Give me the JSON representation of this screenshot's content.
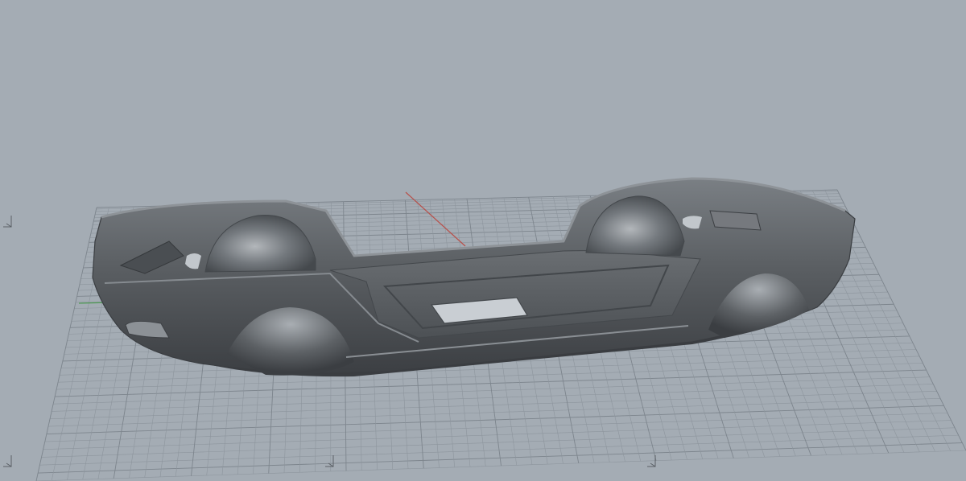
{
  "viewport": {
    "background_color": "#a4acb4",
    "grid_color": "#8d959d",
    "grid_major_color": "#7d858d",
    "x_axis_color": "#b8504a",
    "y_axis_color": "#4f9a55",
    "model_color": "#5f6367",
    "model_shadow_color": "#3d4044",
    "model_highlight_color": "#9ea3a8",
    "axis_gizmo_icons": [
      "axis-triad-icon",
      "axis-triad-icon",
      "axis-triad-icon",
      "axis-triad-icon"
    ]
  }
}
